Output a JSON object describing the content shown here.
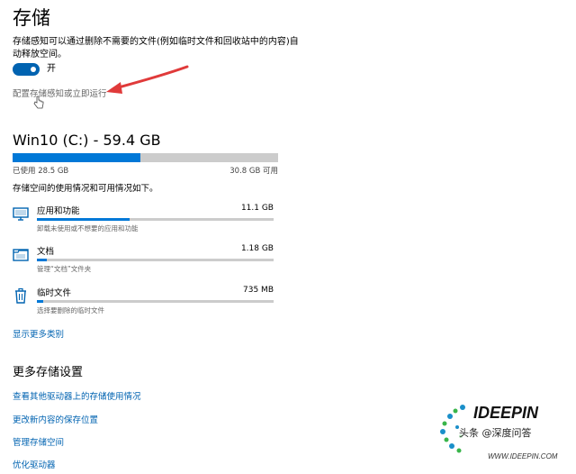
{
  "header": {
    "title": "存储"
  },
  "storage_sense": {
    "description": "存储感知可以通过删除不需要的文件(例如临时文件和回收站中的内容)自动释放空间。",
    "toggle_label": "开",
    "toggle_on": true,
    "config_link": "配置存储感知或立即运行"
  },
  "drive": {
    "title": "Win10 (C:) - 59.4 GB",
    "used_label": "已使用 28.5 GB",
    "free_label": "30.8 GB 可用",
    "used_fraction": 0.48,
    "usage_desc": "存储空间的使用情况和可用情况如下。"
  },
  "categories": [
    {
      "icon": "monitor-icon",
      "name": "应用和功能",
      "size": "11.1 GB",
      "sub": "卸载未使用或不想要的应用和功能",
      "fraction": 0.39
    },
    {
      "icon": "documents-icon",
      "name": "文档",
      "size": "1.18 GB",
      "sub": "管理“文档”文件夹",
      "fraction": 0.04
    },
    {
      "icon": "trash-icon",
      "name": "临时文件",
      "size": "735 MB",
      "sub": "选择要删除的临时文件",
      "fraction": 0.025
    }
  ],
  "show_more": "显示更多类别",
  "more_settings": {
    "title": "更多存储设置",
    "links": [
      "查看其他驱动器上的存储使用情况",
      "更改新内容的保存位置",
      "管理存储空间",
      "优化驱动器"
    ]
  },
  "watermark": {
    "brand": "IDEEPIN",
    "text": "头条 @深度问答",
    "url": "WWW.IDEEPIN.COM"
  },
  "colors": {
    "accent": "#0063b1",
    "bar_fill": "#0078d7",
    "bar_bg": "#cccccc",
    "arrow": "#e03a3a"
  }
}
